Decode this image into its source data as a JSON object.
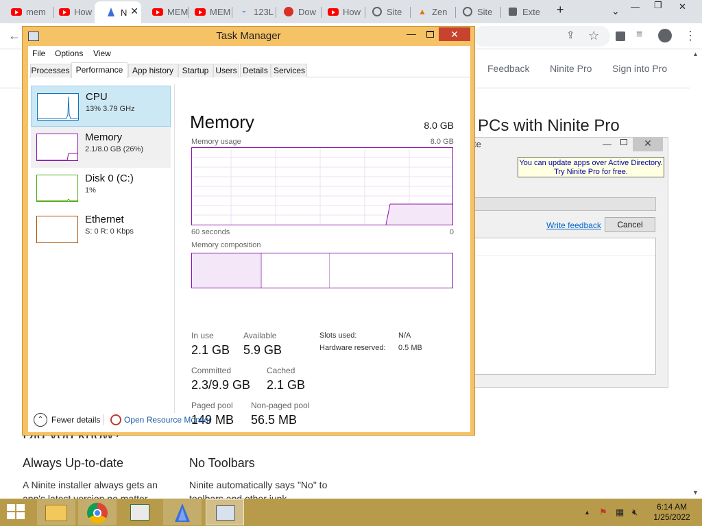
{
  "browser": {
    "tabs": [
      {
        "label": "mem",
        "icon": "youtube-icon"
      },
      {
        "label": "How",
        "icon": "youtube-icon"
      },
      {
        "label": "N",
        "icon": "ninite-icon",
        "active": true
      },
      {
        "label": "MEM",
        "icon": "youtube-icon"
      },
      {
        "label": "MEM",
        "icon": "youtube-icon"
      },
      {
        "label": "123L",
        "icon": "ext-icon"
      },
      {
        "label": "Dow",
        "icon": "download-icon"
      },
      {
        "label": "How",
        "icon": "youtube-icon"
      },
      {
        "label": "Site",
        "icon": "globe-icon"
      },
      {
        "label": "Zen",
        "icon": "zen-icon"
      },
      {
        "label": "Site",
        "icon": "globe-icon"
      },
      {
        "label": "Exte",
        "icon": "puzzle-icon"
      }
    ],
    "new_tab": "+",
    "tab_close": "✕"
  },
  "page": {
    "nav": {
      "feedback": "Feedback",
      "ninite_pro": "Ninite Pro",
      "sign_in": "Sign into Pro"
    },
    "hero": "PCs with Ninite Pro",
    "did_you_know": "Did you know?",
    "col1": {
      "head": "Always Up-to-date",
      "text": "A Ninite installer always gets an app's latest version no matter"
    },
    "col2": {
      "head": "No Toolbars",
      "text": "Ninite automatically says \"No\" to toolbars and other junk"
    }
  },
  "ninite_dialog": {
    "title": "te",
    "tip_line1": "You can update apps over Active Directory.",
    "tip_line2": "Try Ninite Pro for free.",
    "feedback_link": "Write feedback",
    "cancel": "Cancel"
  },
  "task_manager": {
    "title": "Task Manager",
    "menu": {
      "file": "File",
      "options": "Options",
      "view": "View"
    },
    "tabs": [
      "Processes",
      "Performance",
      "App history",
      "Startup",
      "Users",
      "Details",
      "Services"
    ],
    "active_tab": "Performance",
    "sidebar": [
      {
        "name": "CPU",
        "sub": "13%  3.79 GHz",
        "color": "#1175be"
      },
      {
        "name": "Memory",
        "sub": "2.1/8.0 GB (26%)",
        "color": "#8b12ae"
      },
      {
        "name": "Disk 0 (C:)",
        "sub": "1%",
        "color": "#4da60c"
      },
      {
        "name": "Ethernet",
        "sub": "S: 0  R: 0 Kbps",
        "color": "#a74f01"
      }
    ],
    "detail": {
      "title": "Memory",
      "total": "8.0 GB",
      "usage_label": "Memory usage",
      "usage_max": "8.0 GB",
      "time_left": "60 seconds",
      "time_right": "0",
      "composition_label": "Memory composition",
      "stats": {
        "in_use_label": "In use",
        "in_use": "2.1 GB",
        "available_label": "Available",
        "available": "5.9 GB",
        "committed_label": "Committed",
        "committed": "2.3/9.9 GB",
        "cached_label": "Cached",
        "cached": "2.1 GB",
        "paged_label": "Paged pool",
        "paged": "149 MB",
        "nonpaged_label": "Non-paged pool",
        "nonpaged": "56.5 MB",
        "slots_label": "Slots used:",
        "slots": "N/A",
        "hw_label": "Hardware reserved:",
        "hw": "0.5 MB"
      }
    },
    "footer": {
      "fewer": "Fewer details",
      "resmon": "Open Resource Monitor"
    }
  },
  "taskbar": {
    "clock_time": "6:14 AM",
    "clock_date": "1/25/2022"
  }
}
